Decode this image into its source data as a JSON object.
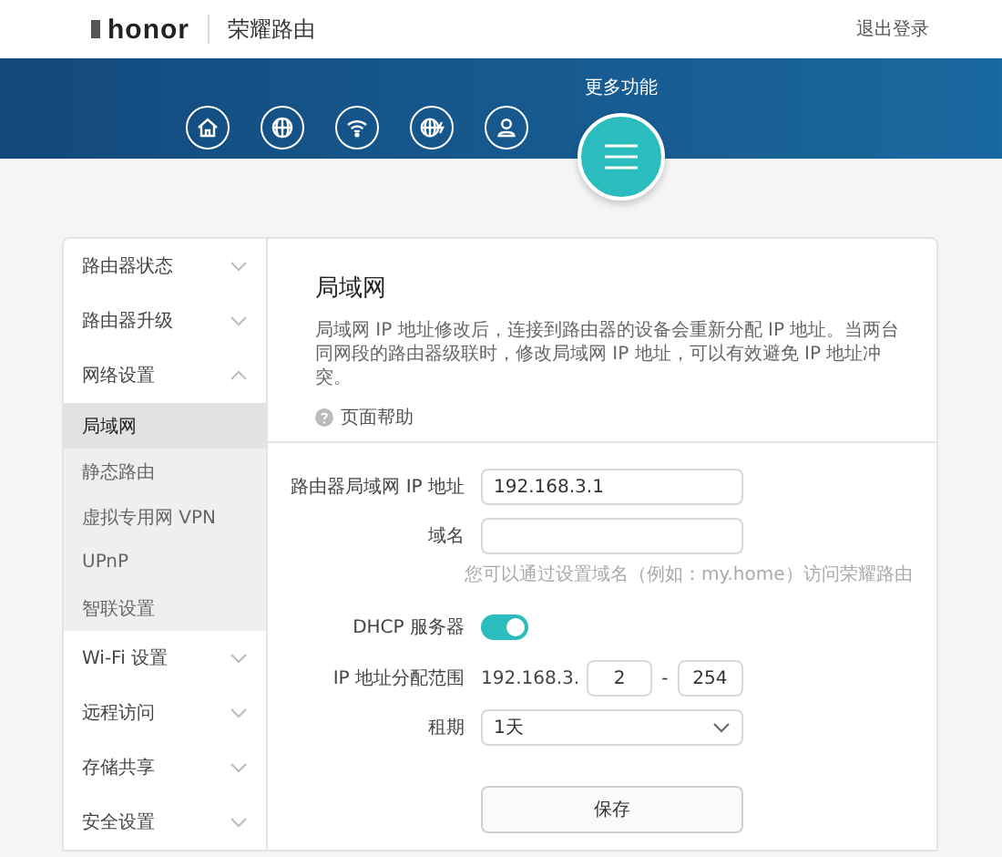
{
  "header": {
    "brand": "honor",
    "product": "荣耀路由",
    "logout": "退出登录"
  },
  "nav": {
    "icons": [
      {
        "kind": "home"
      },
      {
        "kind": "globe"
      },
      {
        "kind": "wifi"
      },
      {
        "kind": "globe-bolt"
      },
      {
        "kind": "user"
      }
    ],
    "more_label": "更多功能"
  },
  "sidebar": {
    "items": [
      {
        "label": "路由器状态",
        "expanded": false
      },
      {
        "label": "路由器升级",
        "expanded": false
      },
      {
        "label": "网络设置",
        "expanded": true,
        "children": [
          {
            "label": "局域网",
            "selected": true
          },
          {
            "label": "静态路由",
            "selected": false
          },
          {
            "label": "虚拟专用网 VPN",
            "selected": false
          },
          {
            "label": "UPnP",
            "selected": false
          },
          {
            "label": "智联设置",
            "selected": false
          }
        ]
      },
      {
        "label": "Wi-Fi 设置",
        "expanded": false
      },
      {
        "label": "远程访问",
        "expanded": false
      },
      {
        "label": "存储共享",
        "expanded": false
      },
      {
        "label": "安全设置",
        "expanded": false
      }
    ]
  },
  "page": {
    "title": "局域网",
    "description": "局域网 IP 地址修改后，连接到路由器的设备会重新分配 IP 地址。当两台同网段的路由器级联时，修改局域网 IP 地址，可以有效避免 IP 地址冲突。",
    "help": "页面帮助",
    "form": {
      "ip_label": "路由器局域网 IP 地址",
      "ip_value": "192.168.3.1",
      "domain_label": "域名",
      "domain_hint": "您可以通过设置域名（例如：my.home）访问荣耀路由",
      "dhcp_label": "DHCP 服务器",
      "dhcp_on": true,
      "range_label": "IP 地址分配范围",
      "range_prefix": "192.168.3.",
      "range_start": "2",
      "range_dash": "-",
      "range_end": "254",
      "lease_label": "租期",
      "lease_value": "1天"
    },
    "save": "保存"
  }
}
